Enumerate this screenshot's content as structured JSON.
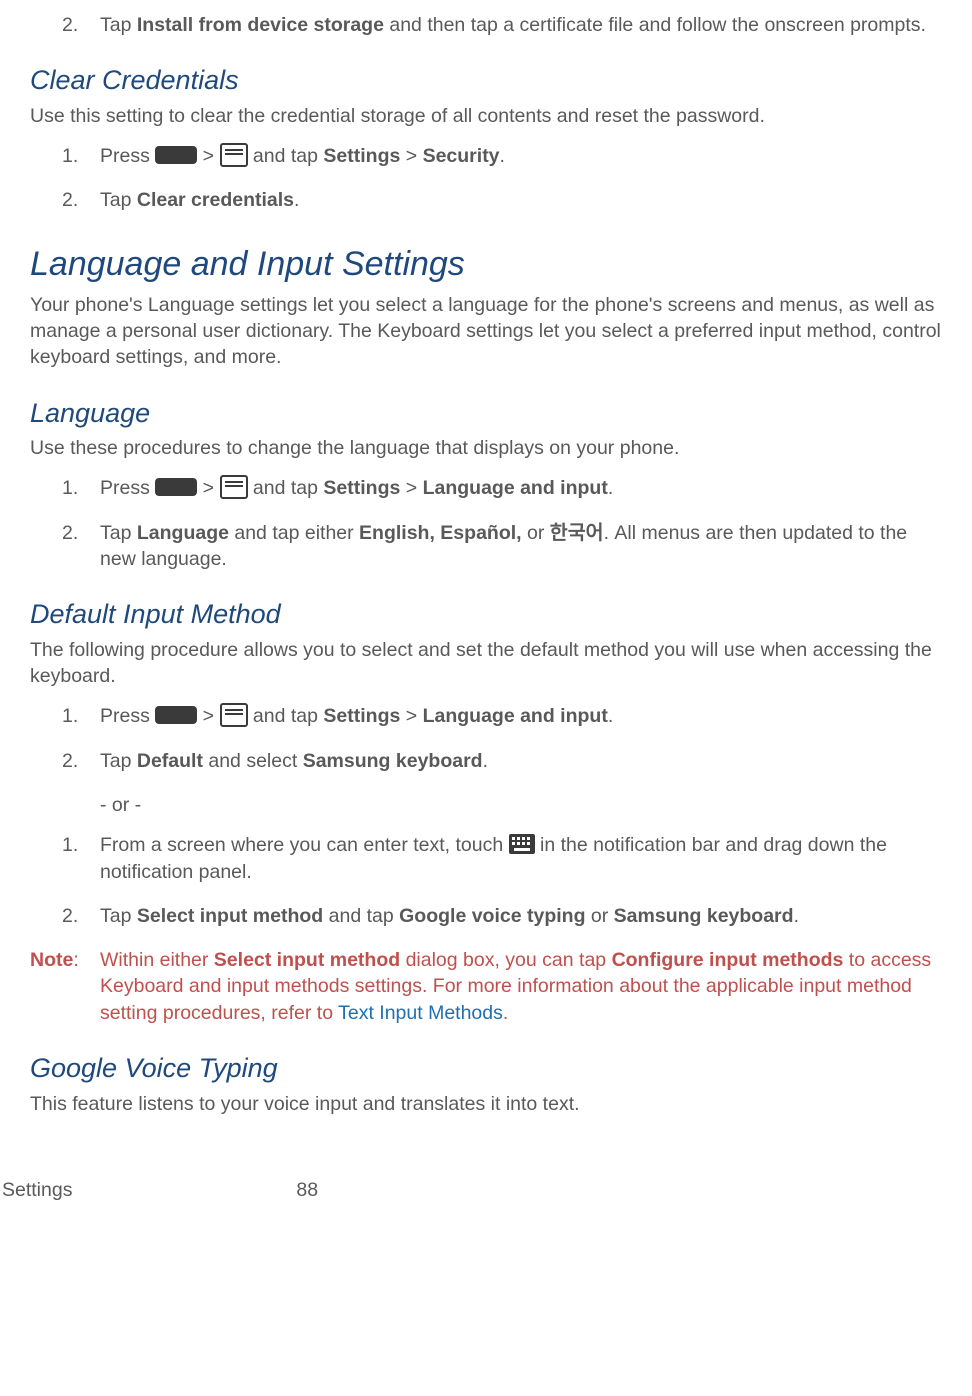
{
  "intro_step": {
    "num": "2.",
    "before": "Tap ",
    "bold": "Install from device storage",
    "after": " and then tap a certificate file and follow the onscreen prompts."
  },
  "sec1": {
    "title": "Clear Credentials",
    "desc": "Use this setting to clear the credential storage of all contents and reset the password.",
    "step1": {
      "num": "1.",
      "press": "Press ",
      "gt": " > ",
      "andtap": " and tap ",
      "settings": "Settings",
      "sep": " > ",
      "security": "Security",
      "end": "."
    },
    "step2": {
      "num": "2.",
      "before": "Tap ",
      "bold": "Clear credentials",
      "after": "."
    }
  },
  "sec2": {
    "title": "Language and Input Settings",
    "desc": "Your phone's Language settings let you select a language for the phone's screens and menus, as well as manage a personal user dictionary. The Keyboard settings let you select a preferred input method, control keyboard settings, and more."
  },
  "sec3": {
    "title": "Language",
    "desc": "Use these procedures to change the language that displays on your phone.",
    "step1": {
      "num": "1.",
      "press": "Press ",
      "gt": " > ",
      "andtap": " and tap ",
      "settings": "Settings",
      "sep": " > ",
      "target": "Language and input",
      "end": "."
    },
    "step2": {
      "num": "2.",
      "t1": "Tap ",
      "b1": "Language",
      "t2": " and tap either ",
      "b2": "English, Español,",
      "t3": " or ",
      "b3": "한국어",
      "t4": ". All menus are then updated to the new language."
    }
  },
  "sec4": {
    "title": "Default Input Method",
    "desc": "The following procedure allows you to select and set the default method you will use when accessing the keyboard.",
    "step1": {
      "num": "1.",
      "press": "Press ",
      "gt": " > ",
      "andtap": " and tap ",
      "settings": "Settings",
      "sep": " > ",
      "target": "Language and input",
      "end": "."
    },
    "step2": {
      "num": "2.",
      "t1": "Tap ",
      "b1": "Default",
      "t2": " and select ",
      "b2": "Samsung keyboard",
      "t3": "."
    },
    "or": "- or -",
    "step3": {
      "num": "1.",
      "t1": "From a screen where you can enter text, touch ",
      "t2": " in the notification bar and drag down the notification panel."
    },
    "step4": {
      "num": "2.",
      "t1": "Tap ",
      "b1": "Select input method",
      "t2": " and tap ",
      "b2": "Google voice typing",
      "t3": " or ",
      "b3": "Samsung keyboard",
      "t4": "."
    }
  },
  "note": {
    "label": "Note",
    "colon": ":",
    "t1": "Within either ",
    "b1": "Select input method",
    "t2": " dialog box, you can tap ",
    "b2": "Configure input methods",
    "t3": " to access Keyboard and input methods settings. For more information about the applicable input method setting procedures, refer to ",
    "link": "Text Input Methods",
    "t4": "."
  },
  "sec5": {
    "title": "Google Voice Typing",
    "desc": "This feature listens to your voice input and translates it into text."
  },
  "footer": {
    "left": "Settings",
    "right": "88"
  }
}
